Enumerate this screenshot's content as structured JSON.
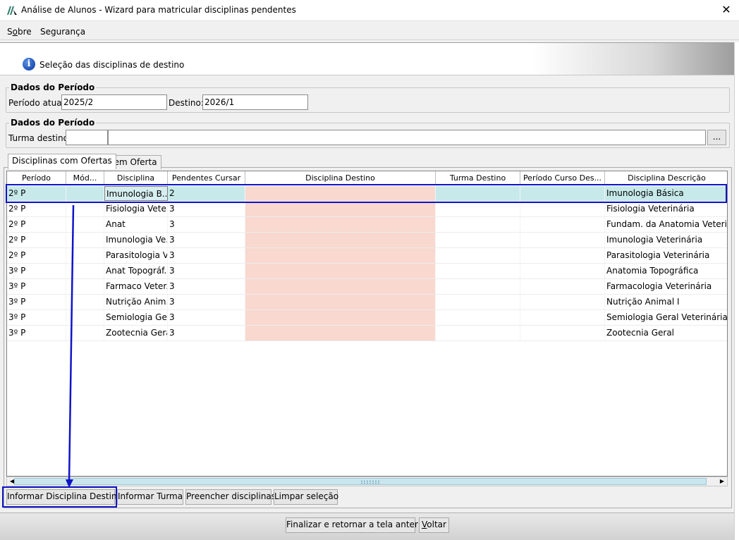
{
  "window": {
    "title": "Análise de Alunos - Wizard para matricular disciplinas pendentes",
    "close": "✕"
  },
  "menu": {
    "sobre": {
      "pre": "S",
      "u": "o",
      "post": "bre"
    },
    "seguranca": "Segurança"
  },
  "banner": {
    "text": "Seleção das disciplinas de destino",
    "icon_glyph": "i"
  },
  "periodo": {
    "legend": "Dados do Período",
    "atual_label": "Período atual:",
    "atual_value": "2025/2",
    "destino_label": "Destino:",
    "destino_value": "2026/1"
  },
  "turma": {
    "legend": "Dados do Período",
    "label": "Turma destino:",
    "code_value": "",
    "name_value": "",
    "browse_label": "..."
  },
  "tabs": [
    "Disciplinas com Ofertas",
    "Sem Oferta"
  ],
  "table": {
    "columns": [
      "Período",
      "Mód...",
      "Disciplina",
      "Pendentes Cursar",
      "Disciplina Destino",
      "Turma Destino",
      "Período Curso Des...",
      "Disciplina Descrição"
    ],
    "rows": [
      [
        "2º P",
        "",
        "Imunologia B...",
        "2",
        "",
        "",
        "",
        "Imunologia Básica"
      ],
      [
        "2º P",
        "",
        "Fisiologia Vete...",
        "3",
        "",
        "",
        "",
        "Fisiologia Veterinária"
      ],
      [
        "2º P",
        "",
        "Anat",
        "3",
        "",
        "",
        "",
        "Fundam. da Anatomia Veterinária"
      ],
      [
        "2º P",
        "",
        "Imunologia Ve...",
        "3",
        "",
        "",
        "",
        "Imunologia Veterinária"
      ],
      [
        "2º P",
        "",
        "Parasitologia V...",
        "3",
        "",
        "",
        "",
        "Parasitologia Veterinária"
      ],
      [
        "3º P",
        "",
        "Anat Topográf...",
        "3",
        "",
        "",
        "",
        "Anatomia Topográfica"
      ],
      [
        "3º P",
        "",
        "Farmaco Veter...",
        "3",
        "",
        "",
        "",
        "Farmacologia Veterinária"
      ],
      [
        "3º P",
        "",
        "Nutrição Anim...",
        "3",
        "",
        "",
        "",
        "Nutrição Animal I"
      ],
      [
        "3º P",
        "",
        "Semiologia Ge...",
        "3",
        "",
        "",
        "",
        "Semiologia Geral Veterinária"
      ],
      [
        "3º P",
        "",
        "Zootecnia Geral",
        "3",
        "",
        "",
        "",
        "Zootecnia Geral"
      ]
    ],
    "selected_row": 0
  },
  "actions": {
    "informar_disciplina": "Informar Disciplina Destino",
    "informar_turma": "Informar Turma",
    "preencher": "Preencher disciplinas",
    "limpar": "Limpar seleção"
  },
  "footer": {
    "finalizar": "Finalizar e retornar a tela anterior",
    "voltar": {
      "u": "V",
      "post": "oltar"
    }
  },
  "colors": {
    "selected_row": "#c7e9ea",
    "destino_cell": "#f8d8cf",
    "annotation": "#1014c8"
  },
  "icons": {
    "app": "app-logo-icon",
    "info": "info-icon",
    "close": "close-icon",
    "scroll_left": "scroll-left-icon",
    "scroll_right": "scroll-right-icon"
  }
}
